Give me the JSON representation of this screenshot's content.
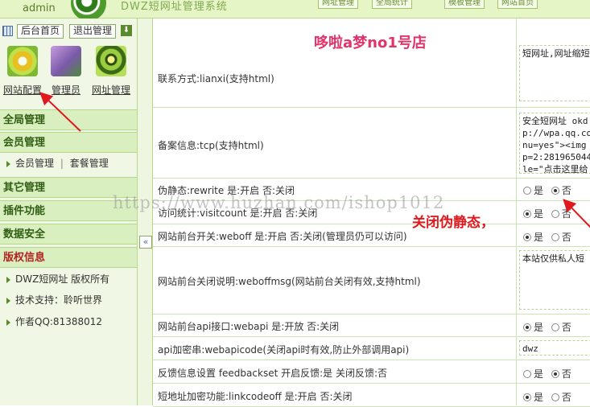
{
  "header": {
    "username": "admin",
    "title": "DWZ短网址管理系统",
    "nav": [
      "网址管理",
      "全局统计",
      "模板管理",
      "网站首页"
    ]
  },
  "sidebar": {
    "home_btn": "后台首页",
    "logout_btn": "退出管理",
    "quick": [
      {
        "label": "网站配置",
        "icon": "gear-icon"
      },
      {
        "label": "管理员",
        "icon": "user-icon"
      },
      {
        "label": "网址管理",
        "icon": "globe-icon"
      }
    ],
    "sections": {
      "global": "全局管理",
      "member": "会员管理",
      "member_items": [
        "会员管理",
        "套餐管理"
      ],
      "other": "其它管理",
      "plugin": "插件功能",
      "datasec": "数据安全",
      "copyright": "版权信息"
    },
    "copyright_items": [
      "DWZ短网址 版权所有",
      "技术支持：聆听世界",
      "作者QQ:81388012"
    ]
  },
  "store_title": "哆啦a梦no1号店",
  "watermark": "https://www.huzhan.com/ishop1012",
  "annotation": "关闭伪静态，",
  "form": {
    "radio_yes": "是",
    "radio_no": "否",
    "rows": [
      {
        "label": "联系方式:lianxi(支持html)",
        "text": "短网址,网址缩短"
      },
      {
        "label": "备案信息:tcp(支持html)",
        "text": "安全短网址 okd\np://wpa.qq.com\nnu=yes\"><img b\np=2:2819650442\nle=\"点击这里给"
      },
      {
        "label": "伪静态:rewrite 是:开启 否:关闭",
        "selected": "no"
      },
      {
        "label": "访问统计:visitcount 是:开启 否:关闭",
        "selected": "yes"
      },
      {
        "label": "网站前台开关:weboff 是:开启 否:关闭(管理员仍可以访问)",
        "selected": "yes"
      },
      {
        "label": "网站前台关闭说明:weboffmsg(网站前台关闭有效,支持html)",
        "text": "本站仅供私人短"
      },
      {
        "label": "网站前台api接口:webapi 是:开放 否:关闭",
        "selected": "yes"
      },
      {
        "label": "api加密串:webapicode(关闭api时有效,防止外部调用api)",
        "text": "dwz"
      },
      {
        "label": "反馈信息设置 feedbackset 开启反馈:是 关闭反馈:否",
        "selected": "no"
      },
      {
        "label": "短地址加密功能:linkcodeoff 是:开启 否:关闭",
        "selected": "yes"
      }
    ]
  },
  "colors": {
    "accent": "#e0191f",
    "store_title": "#e2336a",
    "green_header": "#2f5d12"
  }
}
